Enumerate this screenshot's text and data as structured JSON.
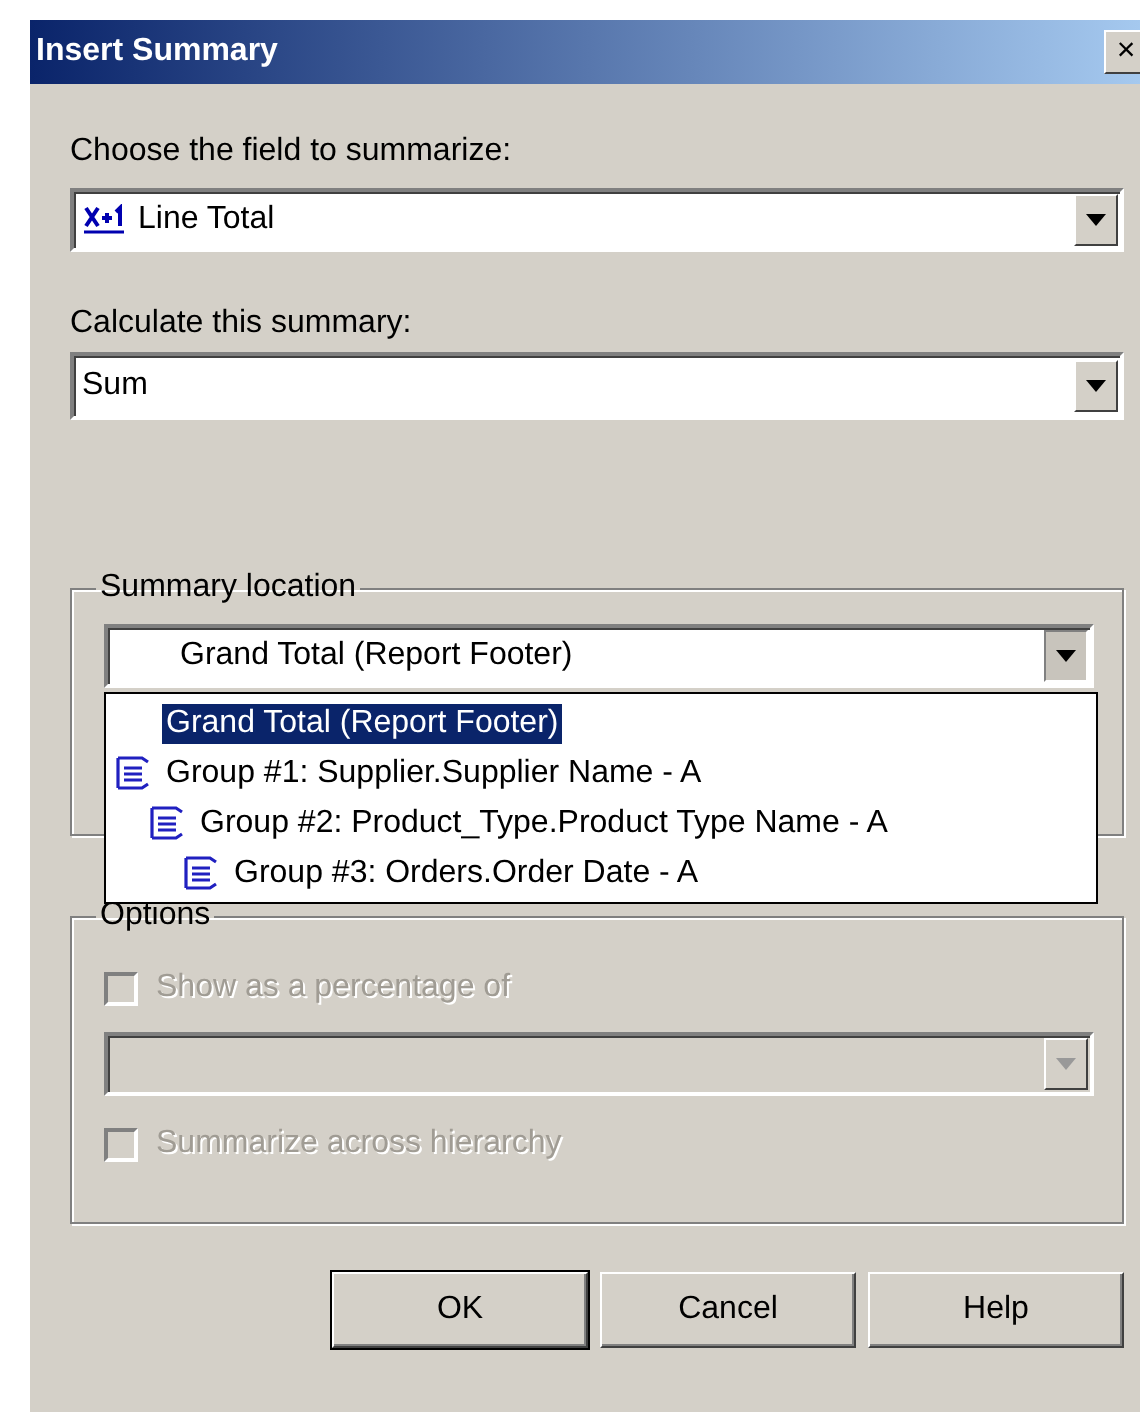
{
  "window": {
    "title": "Insert Summary",
    "close": "×"
  },
  "field": {
    "label": "Choose the field to summarize:",
    "value": "Line Total"
  },
  "summary": {
    "label": "Calculate this summary:",
    "value": "Sum"
  },
  "location": {
    "legend": "Summary location",
    "value": "Grand Total (Report Footer)",
    "expanded": true,
    "items": [
      {
        "kind": "total",
        "label": "Grand Total (Report Footer)",
        "selected": true
      },
      {
        "kind": "group",
        "label": "Group #1: Supplier.Supplier Name - A",
        "selected": false,
        "children": [
          {
            "kind": "group",
            "label": "Group #2: Product_Type.Product Type Name - A",
            "selected": false,
            "children": [
              {
                "kind": "group",
                "label": "Group #3: Orders.Order Date - A",
                "selected": false
              }
            ]
          }
        ]
      }
    ]
  },
  "options": {
    "legend": "Options",
    "checkboxes": [
      {
        "label": "Show as a percentage of",
        "checked": false,
        "disabled": true
      },
      {
        "label": "Summarize across hierarchy",
        "checked": false,
        "disabled": true
      }
    ]
  },
  "buttons": [
    "OK",
    "Cancel",
    "Help"
  ]
}
